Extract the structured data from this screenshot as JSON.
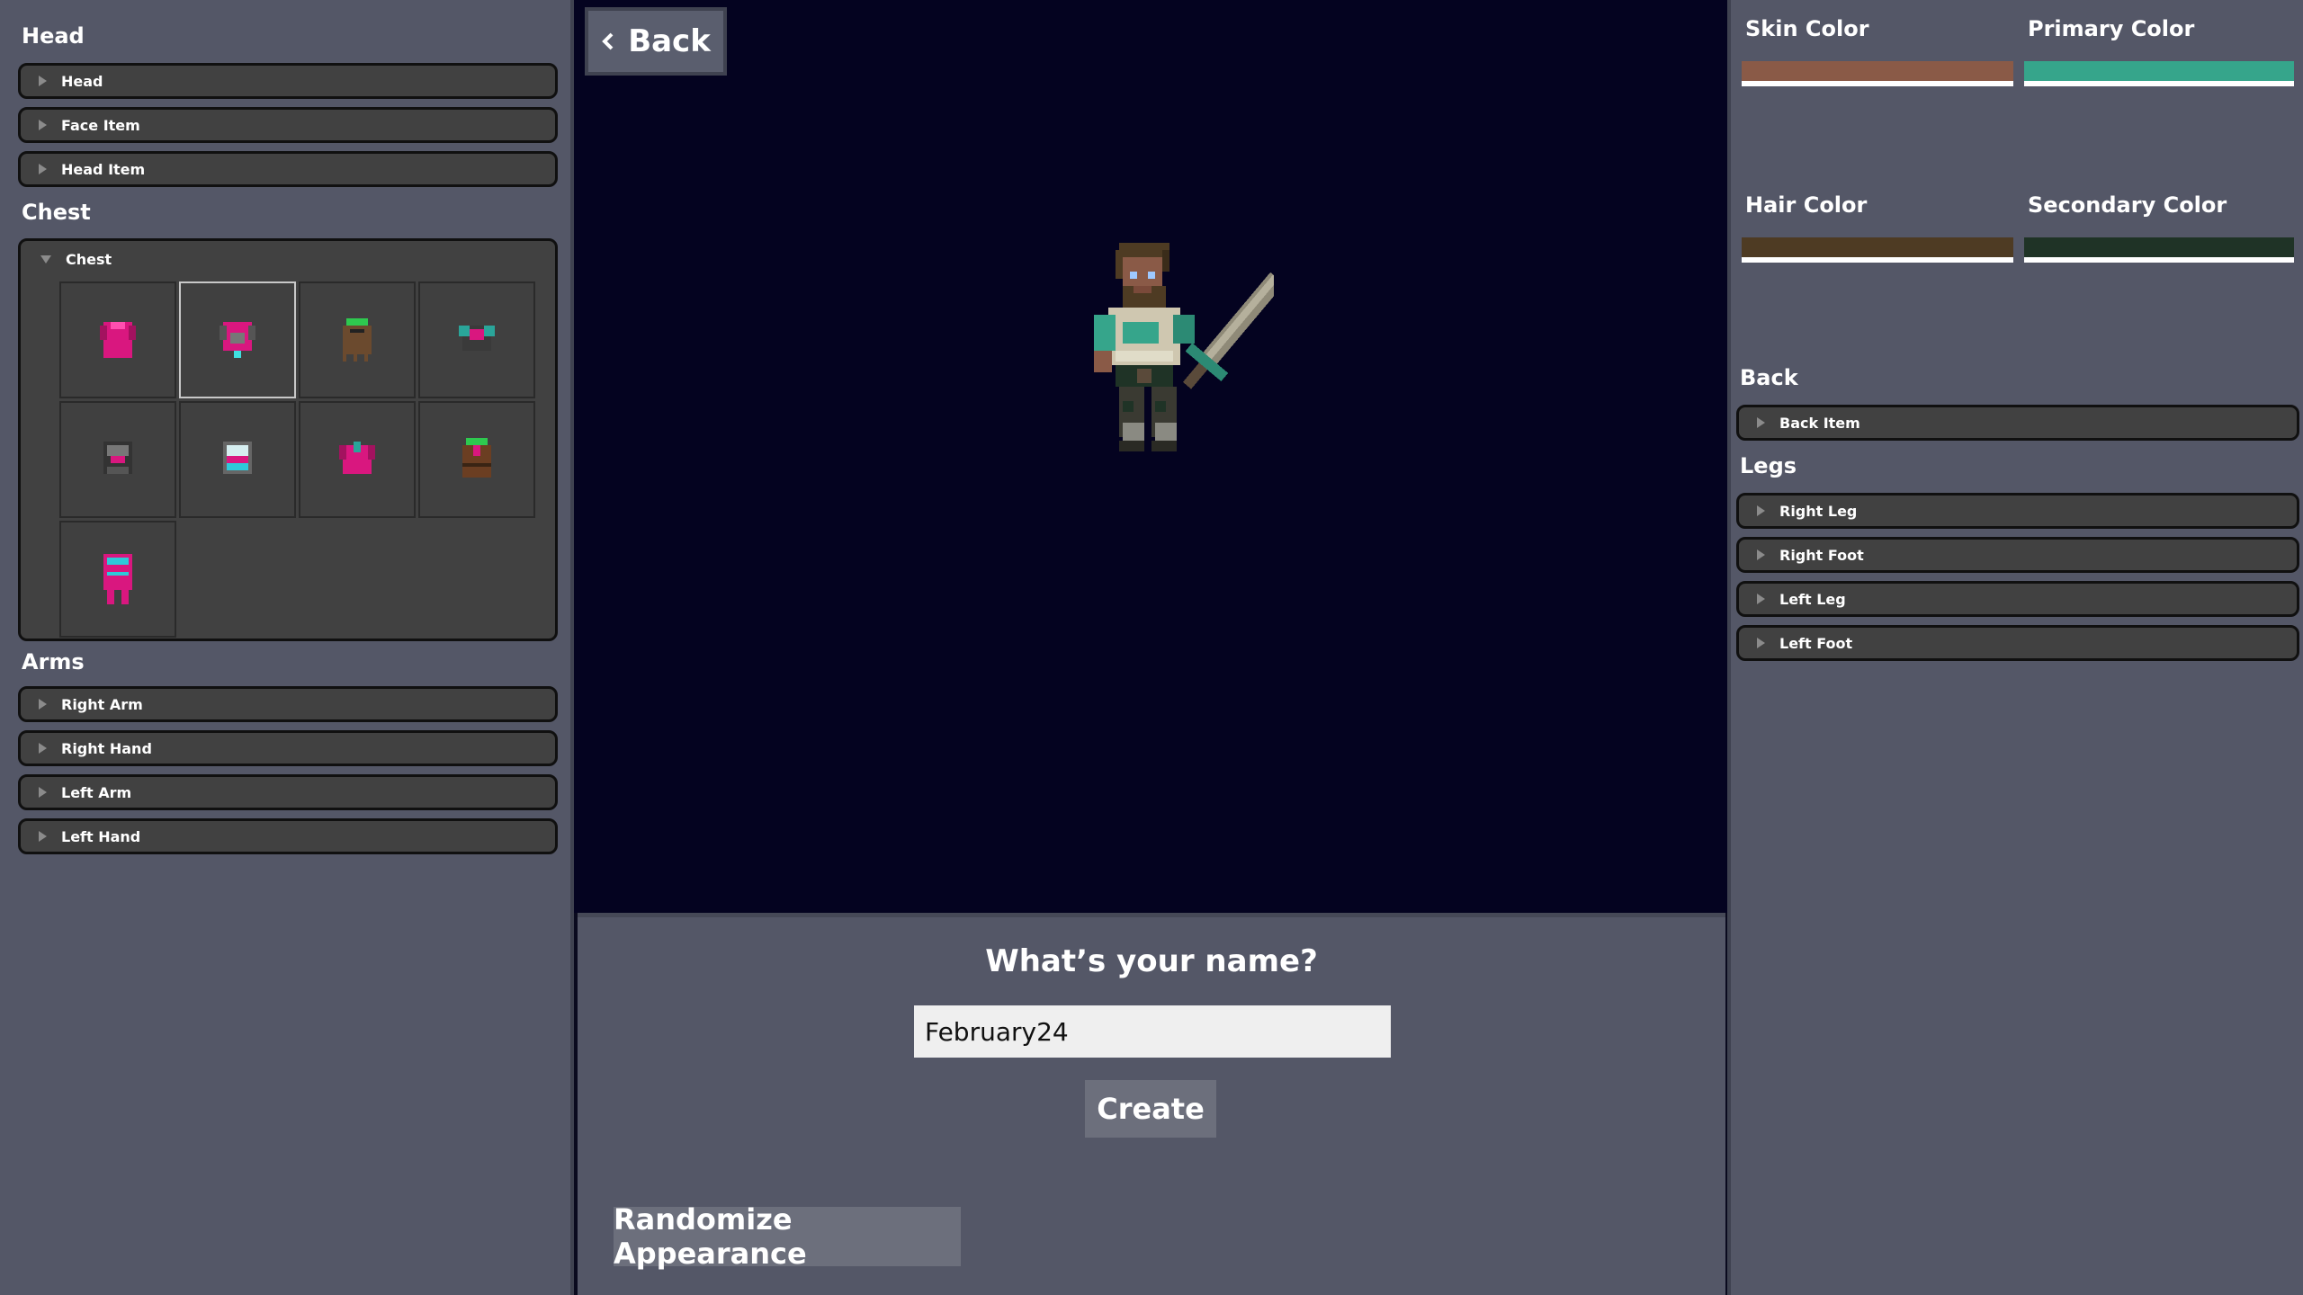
{
  "nav": {
    "back_label": "Back"
  },
  "left": {
    "head_title": "Head",
    "head_items": [
      "Head",
      "Face Item",
      "Head Item"
    ],
    "chest_title": "Chest",
    "chest_open_label": "Chest",
    "chest_slots": [
      {
        "name": "chest-armor-magenta-plain"
      },
      {
        "name": "chest-armor-magenta-grey-harness"
      },
      {
        "name": "chest-armor-brown-green-hooded"
      },
      {
        "name": "chest-armor-dark-teal-collar"
      },
      {
        "name": "chest-armor-grey-magenta-vest"
      },
      {
        "name": "chest-armor-cyan-magenta-plate"
      },
      {
        "name": "chest-armor-magenta-teal-collar"
      },
      {
        "name": "chest-armor-brown-magenta-tunic"
      },
      {
        "name": "chest-armor-magenta-cyan-robe"
      }
    ],
    "chest_selected_index": 1,
    "arms_title": "Arms",
    "arms_items": [
      "Right Arm",
      "Right Hand",
      "Left Arm",
      "Left Hand"
    ]
  },
  "right": {
    "colors": [
      {
        "label": "Skin Color",
        "hex": "#8a5a47"
      },
      {
        "label": "Primary Color",
        "hex": "#36a58b"
      },
      {
        "label": "Hair Color",
        "hex": "#4e3b23"
      },
      {
        "label": "Secondary Color",
        "hex": "#1f3326"
      }
    ],
    "back_title": "Back",
    "back_items": [
      "Back Item"
    ],
    "legs_title": "Legs",
    "legs_items": [
      "Right Leg",
      "Right Foot",
      "Left Leg",
      "Left Foot"
    ]
  },
  "creation": {
    "question": "What’s your name?",
    "name_value": "February24",
    "create_label": "Create",
    "randomize_label": "Randomize Appearance"
  }
}
